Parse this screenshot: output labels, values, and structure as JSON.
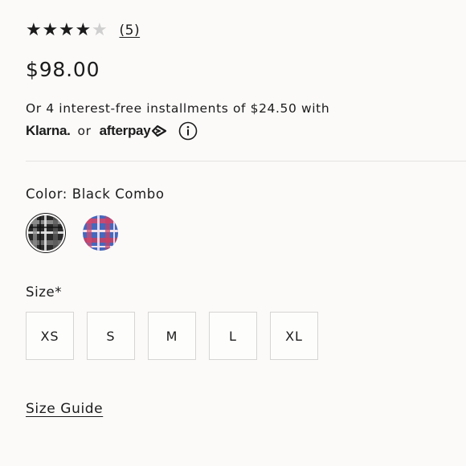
{
  "rating": {
    "stars_filled": 4,
    "stars_total": 5,
    "review_count_text": "(5)"
  },
  "price": "$98.00",
  "installments_text": "Or 4 interest-free installments of $24.50 with",
  "payment": {
    "klarna_label": "Klarna.",
    "or_text": "or",
    "afterpay_label": "afterpay",
    "afterpay_icon": "afterpay-arrows-icon",
    "info_icon": "info-circle-icon"
  },
  "color": {
    "label": "Color: Black Combo",
    "swatches": [
      {
        "name": "Black Combo",
        "selected": true,
        "colors": [
          "#1c1c1c",
          "#6d6d6d",
          "#e6e6e6"
        ]
      },
      {
        "name": "Blue/Pink Plaid",
        "selected": false,
        "colors": [
          "#3b5fb0",
          "#d74a6b",
          "#f1dfe8"
        ]
      }
    ]
  },
  "size": {
    "label": "Size*",
    "options": [
      "XS",
      "S",
      "M",
      "L",
      "XL"
    ]
  },
  "size_guide_label": "Size Guide"
}
